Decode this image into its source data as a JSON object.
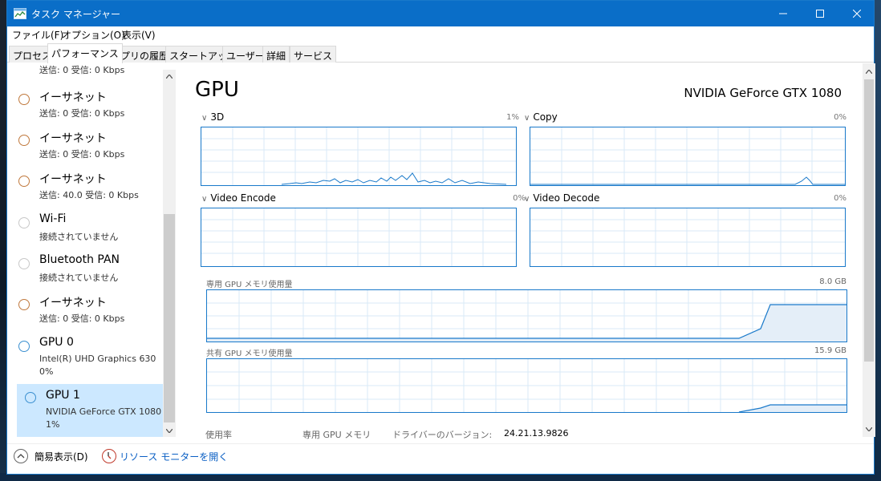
{
  "window": {
    "title": "タスク マネージャー",
    "colors": {
      "titlebar": "#0a6ec8",
      "accent": "#1979ca",
      "selected": "#cce8ff",
      "link": "#0a5fc4"
    }
  },
  "menu": [
    "ファイル(F)",
    "オプション(O)",
    "表示(V)"
  ],
  "tabs": [
    "プロセス",
    "パフォーマンス",
    "アプリの履歴",
    "スタートアップ",
    "ユーザー",
    "詳細",
    "サービス"
  ],
  "active_tab": "パフォーマンス",
  "sidebar": {
    "top_partial": "送信: 0 受信: 0 Kbps",
    "items": [
      {
        "name": "イーサネット",
        "sub1": "送信: 0 受信: 0 Kbps",
        "sub2": ""
      },
      {
        "name": "イーサネット",
        "sub1": "送信: 0 受信: 0 Kbps",
        "sub2": ""
      },
      {
        "name": "イーサネット",
        "sub1": "送信: 40.0 受信: 0 Kbps",
        "sub2": ""
      },
      {
        "name": "Wi-Fi",
        "sub1": "接続されていません",
        "sub2": ""
      },
      {
        "name": "Bluetooth PAN",
        "sub1": "接続されていません",
        "sub2": ""
      },
      {
        "name": "イーサネット",
        "sub1": "送信: 0 受信: 0 Kbps",
        "sub2": ""
      },
      {
        "name": "GPU 0",
        "sub1": "Intel(R) UHD Graphics 630",
        "sub2": "0%"
      },
      {
        "name": "GPU 1",
        "sub1": "NVIDIA GeForce GTX 1080",
        "sub2": "1%"
      }
    ]
  },
  "main": {
    "title": "GPU",
    "model": "NVIDIA GeForce GTX 1080",
    "graphs": [
      {
        "label": "3D",
        "pct": "1%"
      },
      {
        "label": "Copy",
        "pct": "0%"
      },
      {
        "label": "Video Encode",
        "pct": "0%"
      },
      {
        "label": "Video Decode",
        "pct": "0%"
      }
    ],
    "dedicated_label": "専用 GPU メモリ使用量",
    "dedicated_max": "8.0 GB",
    "shared_label": "共有 GPU メモリ使用量",
    "shared_max": "15.9 GB",
    "stats": {
      "usage_label": "使用率",
      "dedicated_mem_label": "専用 GPU メモリ",
      "driver_label": "ドライバーのバージョン:",
      "driver_value": "24.21.13.9826"
    }
  },
  "footer": {
    "fewer_details": "簡易表示(D)",
    "resource_monitor": "リソース モニターを開く"
  }
}
